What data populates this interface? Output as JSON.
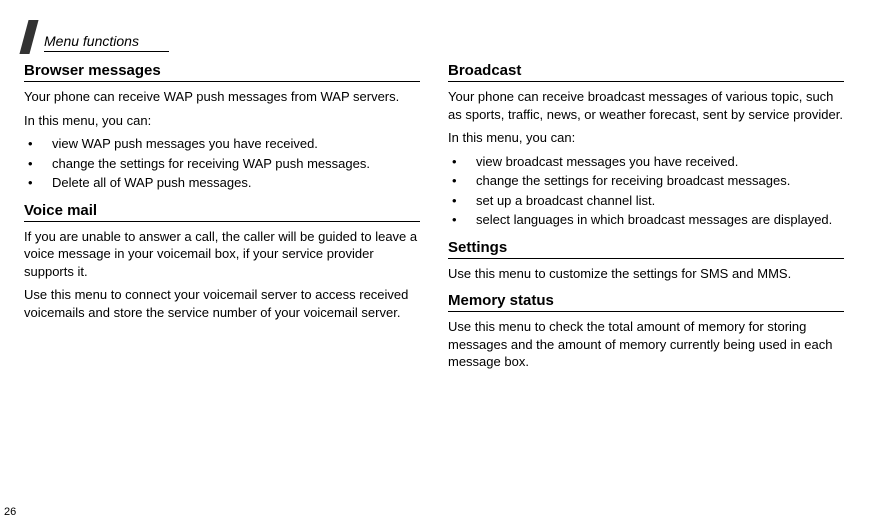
{
  "header": {
    "label": "Menu functions"
  },
  "page_number": "26",
  "left": {
    "s1": {
      "title": "Browser messages",
      "p1": "Your phone can receive WAP push messages from WAP servers.",
      "p2": "In this menu, you can:",
      "bullets": [
        "view WAP push messages you have received.",
        "change the settings for receiving WAP push messages.",
        "Delete all of WAP push messages."
      ]
    },
    "s2": {
      "title": "Voice mail",
      "p1": "If you are unable to answer a call, the caller will be guided to leave a voice message in your voicemail box, if your service provider supports it.",
      "p2": "Use this menu to connect your voicemail server to access received voicemails and store the service number of your voicemail server."
    }
  },
  "right": {
    "s1": {
      "title": "Broadcast",
      "p1": "Your phone can receive broadcast messages of various topic, such as sports, traffic, news, or weather forecast, sent by service provider.",
      "p2": "In this menu, you can:",
      "bullets": [
        "view broadcast messages you have received.",
        "change the settings for receiving broadcast messages.",
        "set up a broadcast channel list.",
        "select languages in which broadcast messages are displayed."
      ]
    },
    "s2": {
      "title": "Settings",
      "p1": "Use this menu to customize the settings for SMS and MMS."
    },
    "s3": {
      "title": "Memory status",
      "p1": "Use this menu to check the total amount of memory for storing messages and the amount of memory currently being used in each message box."
    }
  }
}
